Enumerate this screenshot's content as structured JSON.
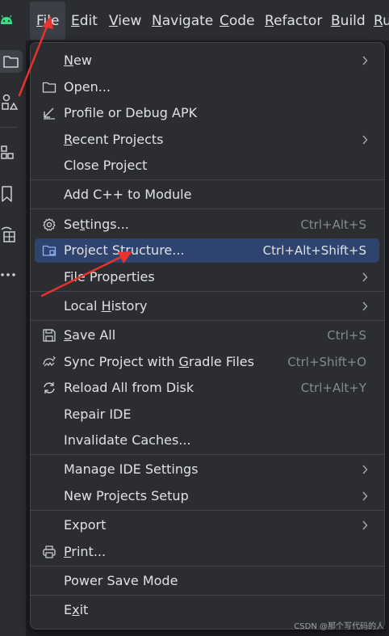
{
  "menubar": {
    "items": [
      {
        "mnemonic": "F",
        "rest": "ile"
      },
      {
        "mnemonic": "E",
        "rest": "dit"
      },
      {
        "mnemonic": "V",
        "rest": "iew"
      },
      {
        "mnemonic": "N",
        "rest": "avigate"
      },
      {
        "mnemonic": "C",
        "rest": "ode"
      },
      {
        "mnemonic": "R",
        "rest": "efactor"
      },
      {
        "mnemonic": "B",
        "rest": "uild"
      },
      {
        "mnemonic": "R",
        "rest": "u"
      }
    ]
  },
  "file_menu": {
    "items": [
      {
        "pre": "",
        "mnemonic": "N",
        "post": "ew",
        "shortcut": "",
        "icon": "",
        "submenu": true
      },
      {
        "pre": "Open...",
        "mnemonic": "",
        "post": "",
        "shortcut": "",
        "icon": "folder-icon",
        "submenu": false
      },
      {
        "pre": "Profile or Debug APK",
        "mnemonic": "",
        "post": "",
        "shortcut": "",
        "icon": "arrow-down-left-icon",
        "submenu": false
      },
      {
        "pre": "",
        "mnemonic": "R",
        "post": "ecent Projects",
        "shortcut": "",
        "icon": "",
        "submenu": true
      },
      {
        "pre": "Close Project",
        "mnemonic": "",
        "post": "",
        "shortcut": "",
        "icon": "",
        "submenu": false
      },
      {
        "pre": "Add C++ to Module",
        "mnemonic": "",
        "post": "",
        "shortcut": "",
        "icon": "",
        "submenu": false
      },
      {
        "pre": "Se",
        "mnemonic": "t",
        "post": "tings...",
        "shortcut": "Ctrl+Alt+S",
        "icon": "gear-icon",
        "submenu": false
      },
      {
        "pre": "Project Structure...",
        "mnemonic": "",
        "post": "",
        "shortcut": "Ctrl+Alt+Shift+S",
        "icon": "folder-grid-icon",
        "submenu": false
      },
      {
        "pre": "File Properties",
        "mnemonic": "",
        "post": "",
        "shortcut": "",
        "icon": "",
        "submenu": true
      },
      {
        "pre": "Local ",
        "mnemonic": "H",
        "post": "istory",
        "shortcut": "",
        "icon": "",
        "submenu": true
      },
      {
        "pre": "",
        "mnemonic": "S",
        "post": "ave All",
        "shortcut": "Ctrl+S",
        "icon": "save-icon",
        "submenu": false
      },
      {
        "pre": "Sync Project with ",
        "mnemonic": "G",
        "post": "radle Files",
        "shortcut": "Ctrl+Shift+O",
        "icon": "gradle-sync-icon",
        "submenu": false
      },
      {
        "pre": "Reload All from Disk",
        "mnemonic": "",
        "post": "",
        "shortcut": "Ctrl+Alt+Y",
        "icon": "reload-icon",
        "submenu": false
      },
      {
        "pre": "Repair IDE",
        "mnemonic": "",
        "post": "",
        "shortcut": "",
        "icon": "",
        "submenu": false
      },
      {
        "pre": "Invalidate Caches...",
        "mnemonic": "",
        "post": "",
        "shortcut": "",
        "icon": "",
        "submenu": false
      },
      {
        "pre": "Manage IDE Settings",
        "mnemonic": "",
        "post": "",
        "shortcut": "",
        "icon": "",
        "submenu": true
      },
      {
        "pre": "New Projects Setup",
        "mnemonic": "",
        "post": "",
        "shortcut": "",
        "icon": "",
        "submenu": true
      },
      {
        "pre": "Export",
        "mnemonic": "",
        "post": "",
        "shortcut": "",
        "icon": "",
        "submenu": true
      },
      {
        "pre": "",
        "mnemonic": "P",
        "post": "rint...",
        "shortcut": "",
        "icon": "print-icon",
        "submenu": false
      },
      {
        "pre": "Power Save Mode",
        "mnemonic": "",
        "post": "",
        "shortcut": "",
        "icon": "",
        "submenu": false
      },
      {
        "pre": "E",
        "mnemonic": "x",
        "post": "it",
        "shortcut": "",
        "icon": "",
        "submenu": false
      }
    ]
  },
  "watermark": "CSDN @那个写代码的人",
  "colors": {
    "background": "#2b2d30",
    "highlight": "#2e436e",
    "text": "#dfe1e5",
    "shortcut": "#868991",
    "annotation": "#e8322e"
  }
}
